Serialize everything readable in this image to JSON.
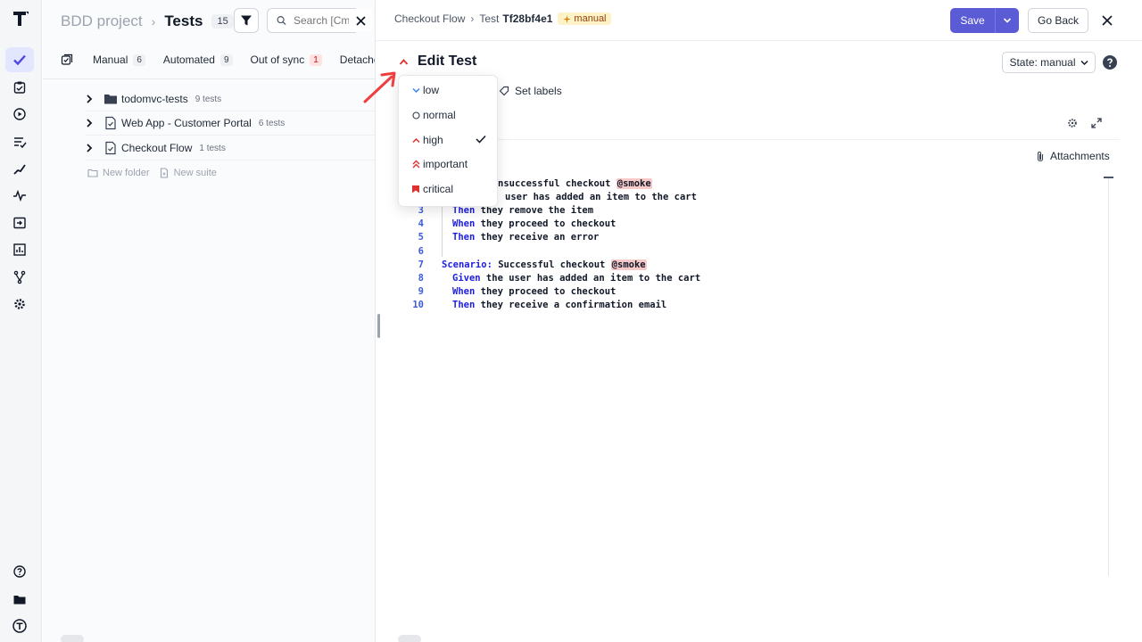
{
  "left_panel": {
    "project": "BDD project",
    "title": "Tests",
    "count": "15",
    "search_placeholder": "Search [Cmd+K]",
    "tabs": [
      {
        "label": "Manual",
        "count": "6"
      },
      {
        "label": "Automated",
        "count": "9"
      },
      {
        "label": "Out of sync",
        "count": "1"
      },
      {
        "label": "Detached",
        "count": ""
      }
    ],
    "tree": [
      {
        "name": "todomvc-tests",
        "count": "9 tests",
        "icon": "folder-icon"
      },
      {
        "name": "Web App - Customer Portal",
        "count": "6 tests",
        "icon": "suite-icon"
      },
      {
        "name": "Checkout Flow",
        "count": "1 tests",
        "icon": "suite-icon"
      }
    ],
    "new_folder": "New folder",
    "new_suite": "New suite"
  },
  "right_panel": {
    "breadcrumb_suite": "Checkout Flow",
    "breadcrumb_test_prefix": "Test",
    "test_id": "Tf28bf4e1",
    "state_badge": "manual",
    "save_label": "Save",
    "go_back_label": "Go Back",
    "edit_title": "Edit Test",
    "state_label": "State: manual",
    "set_labels": "Set labels",
    "attachments": "Attachments"
  },
  "priority_menu": {
    "items": [
      {
        "label": "low",
        "icon": "chevron-down-icon",
        "selected": false
      },
      {
        "label": "normal",
        "icon": "circle-icon",
        "selected": false
      },
      {
        "label": "high",
        "icon": "chevron-up-icon",
        "selected": true
      },
      {
        "label": "important",
        "icon": "double-chevron-up-icon",
        "selected": false
      },
      {
        "label": "critical",
        "icon": "flag-icon",
        "selected": false
      }
    ]
  },
  "code_lines": [
    {
      "n": "",
      "kw": "",
      "text": "nsuccessful checkout ",
      "tag": "@smoke"
    },
    {
      "n": "",
      "kw": "",
      "text": "user has added an item to the cart",
      "tag": ""
    },
    {
      "n": "3",
      "kw": "Then",
      "text": " they remove the item",
      "tag": ""
    },
    {
      "n": "4",
      "kw": "When",
      "text": " they proceed to checkout",
      "tag": ""
    },
    {
      "n": "5",
      "kw": "Then",
      "text": " they receive an error",
      "tag": ""
    },
    {
      "n": "6",
      "kw": "",
      "text": "",
      "tag": ""
    },
    {
      "n": "7",
      "kw": "Scenario:",
      "text": " Successful checkout ",
      "tag": "@smoke"
    },
    {
      "n": "8",
      "kw": "Given",
      "text": " the user has added an item to the cart",
      "tag": ""
    },
    {
      "n": "9",
      "kw": "When",
      "text": " they proceed to checkout",
      "tag": ""
    },
    {
      "n": "10",
      "kw": "Then",
      "text": " they receive a confirmation email",
      "tag": ""
    }
  ],
  "colors": {
    "accent": "#5b5bd6",
    "keyword": "#1d1de0",
    "tag_bg": "#f7c9c9",
    "priority_red": "#e03131"
  }
}
